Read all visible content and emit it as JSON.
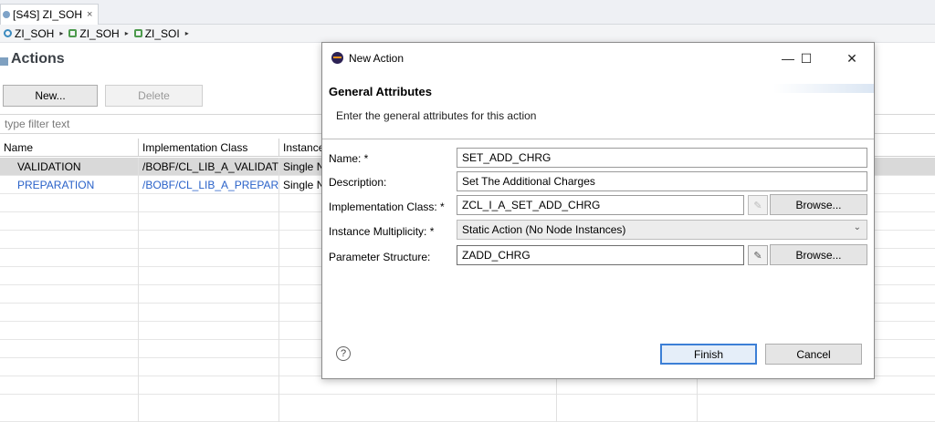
{
  "editor": {
    "tab_label": "[S4S] ZI_SOH",
    "tab_close": "×",
    "breadcrumb": [
      "ZI_SOH",
      "ZI_SOH",
      "ZI_SOI"
    ],
    "breadcrumb_sep": "▸",
    "section_title": "Actions",
    "new_button": "New...",
    "delete_button": "Delete",
    "filter_placeholder": "type filter text",
    "columns": [
      "Name",
      "Implementation Class",
      "Instance"
    ],
    "rows": [
      {
        "name": "VALIDATION",
        "impl": "/BOBF/CL_LIB_A_VALIDATIO",
        "instance": "Single N"
      },
      {
        "name": "PREPARATION",
        "impl": "/BOBF/CL_LIB_A_PREPARAT",
        "instance": "Single N"
      }
    ]
  },
  "dialog": {
    "title": "New Action",
    "window_buttons": {
      "minimize": "—",
      "maximize": "☐",
      "close": "✕"
    },
    "banner_title": "General Attributes",
    "banner_subtitle": "Enter the general attributes for this action",
    "fields": {
      "name_label": "Name: *",
      "name_value": "SET_ADD_CHRG",
      "description_label": "Description:",
      "description_value": "Set The Additional Charges",
      "impl_class_label": "Implementation Class: *",
      "impl_class_value": "ZCL_I_A_SET_ADD_CHRG",
      "multiplicity_label": "Instance Multiplicity: *",
      "multiplicity_value": "Static Action (No Node Instances)",
      "param_structure_label": "Parameter Structure:",
      "param_structure_value": "ZADD_CHRG"
    },
    "browse_label": "Browse...",
    "help_label": "?",
    "finish_label": "Finish",
    "cancel_label": "Cancel"
  },
  "colors": {
    "link_blue": "#2a62c9",
    "default_button_border": "#3c7fd6",
    "selected_row": "#d9d9d9"
  }
}
